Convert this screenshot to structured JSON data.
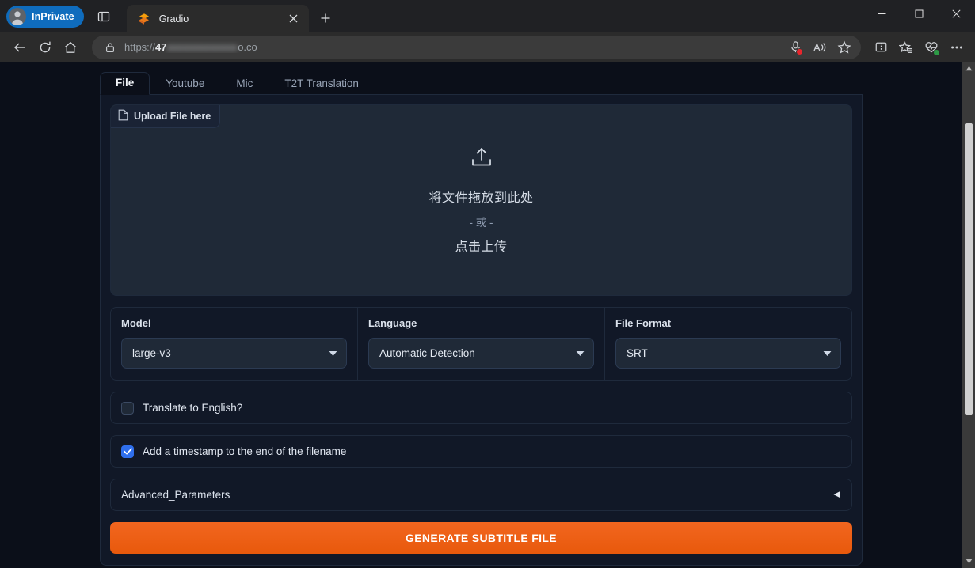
{
  "browser": {
    "profile_label": "InPrivate",
    "tab": {
      "title": "Gradio",
      "favicon": "gradio-logo-icon"
    },
    "url": {
      "scheme": "https://",
      "visible_prefix": "47",
      "redacted": "xxxxxxxxxxxxx",
      "suffix": "o.co"
    },
    "icons": {
      "tab_search": "tab-search-icon",
      "new_tab": "new-tab-plus-icon",
      "back": "back-arrow-icon",
      "reload": "reload-icon",
      "home": "home-icon",
      "lock": "lock-icon",
      "microphone": "microphone-icon",
      "read_aloud": "read-aloud-icon",
      "favorite": "favorite-star-icon",
      "split_screen": "split-screen-icon",
      "favorites_list": "favorites-list-icon",
      "browser_essentials": "browser-essentials-icon",
      "settings_more": "settings-and-more-icon",
      "minimize": "minimize-icon",
      "maximize": "maximize-icon",
      "close": "close-icon"
    }
  },
  "app": {
    "tabs": [
      {
        "label": "File",
        "active": true
      },
      {
        "label": "Youtube",
        "active": false
      },
      {
        "label": "Mic",
        "active": false
      },
      {
        "label": "T2T Translation",
        "active": false
      }
    ],
    "upload": {
      "label": "Upload File here",
      "icon": "file-document-icon",
      "drop_icon": "upload-arrow-icon",
      "drop_text": "将文件拖放到此处",
      "or_text": "- 或 -",
      "click_text": "点击上传"
    },
    "fields": [
      {
        "label": "Model",
        "value": "large-v3",
        "name": "model"
      },
      {
        "label": "Language",
        "value": "Automatic Detection",
        "name": "language"
      },
      {
        "label": "File Format",
        "value": "SRT",
        "name": "file-format"
      }
    ],
    "checkboxes": [
      {
        "label": "Translate to English?",
        "checked": false,
        "name": "translate-to-english"
      },
      {
        "label": "Add a timestamp to the end of the filename",
        "checked": true,
        "name": "add-timestamp"
      }
    ],
    "accordion": {
      "title": "Advanced_Parameters",
      "arrow": "◀",
      "expanded": false
    },
    "submit_button": {
      "label": "GENERATE SUBTITLE FILE"
    }
  },
  "colors": {
    "accent_orange": "#e8590c",
    "checkbox_blue": "#2f6fed",
    "page_bg": "#0b0f19",
    "panel_bg": "#111827",
    "inprivate_blue": "#0f6cbd"
  }
}
